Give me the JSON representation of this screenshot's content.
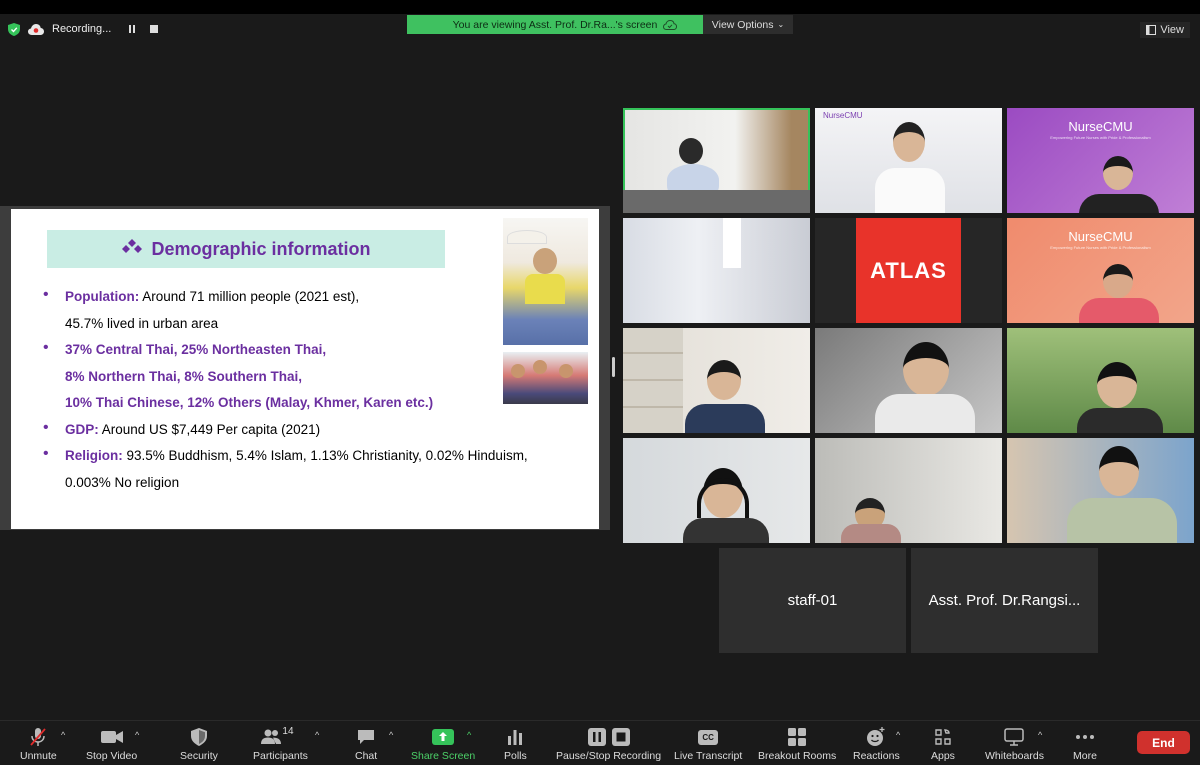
{
  "recording": {
    "label": "Recording..."
  },
  "banner": {
    "viewing_text": "You are viewing Asst. Prof. Dr.Ra...'s screen",
    "options_label": "View Options"
  },
  "view_button": {
    "label": "View"
  },
  "slide": {
    "title": "Demographic information",
    "bullets": [
      {
        "lead": "Population:",
        "text": " Around 71 million people (2021 est),",
        "line2": "45.7% lived in urban area"
      },
      {
        "lines": [
          "37% Central Thai, 25% Northeasten Thai,",
          "8% Northern Thai, 8% Southern Thai,",
          "10% Thai Chinese, 12% Others (Malay, Khmer, Karen etc.)"
        ]
      },
      {
        "lead": "GDP:",
        "text": " Around US $7,449 Per capita (2021)"
      },
      {
        "lead": "Religion:",
        "text": " 93.5% Buddhism, 5.4% Islam, 1.13% Christianity, 0.02% Hinduism,",
        "line2": "0.003% No religion"
      }
    ]
  },
  "tiles": {
    "nursecmu_logo": "NurseCMU",
    "nursecmu_title": "NurseCMU",
    "nursecmu_sub": "Empowering Future Nurses with Pride & Professionalism",
    "atlas": "ATLAS",
    "name_tiles": [
      "staff-01",
      "Asst. Prof. Dr.Rangsi..."
    ]
  },
  "toolbar": {
    "unmute": "Unmute",
    "stop_video": "Stop Video",
    "security": "Security",
    "participants": "Participants",
    "participants_count": "14",
    "chat": "Chat",
    "share_screen": "Share Screen",
    "polls": "Polls",
    "pause_stop": "Pause/Stop Recording",
    "live_transcript": "Live Transcript",
    "cc": "CC",
    "breakout": "Breakout Rooms",
    "reactions": "Reactions",
    "apps": "Apps",
    "whiteboards": "Whiteboards",
    "more": "More",
    "end": "End"
  },
  "colors": {
    "accent_green": "#3fc160",
    "end_red": "#d0312d",
    "slide_purple": "#6b2fa0"
  }
}
